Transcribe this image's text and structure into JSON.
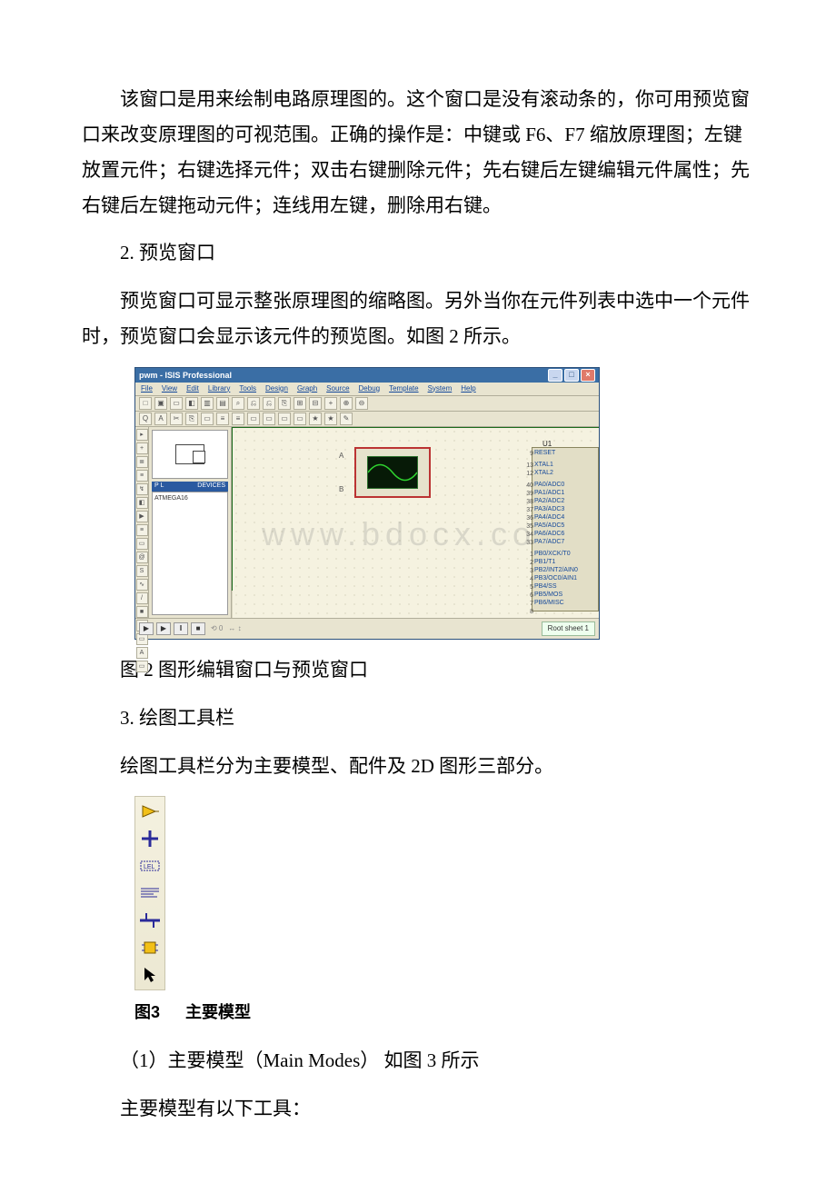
{
  "paragraphs": {
    "p1": "该窗口是用来绘制电路原理图的。这个窗口是没有滚动条的，你可用预览窗口来改变原理图的可视范围。正确的操作是：中键或 F6、F7 缩放原理图；左键放置元件；右键选择元件；双击右键删除元件；先右键后左键编辑元件属性；先右键后左键拖动元件；连线用左键，删除用右键。",
    "p2": "2. 预览窗口",
    "p3": "预览窗口可显示整张原理图的缩略图。另外当你在元件列表中选中一个元件时，预览窗口会显示该元件的预览图。如图 2 所示。",
    "caption2": "图 2 图形编辑窗口与预览窗口",
    "p4": "3. 绘图工具栏",
    "p5": "绘图工具栏分为主要模型、配件及 2D 图形三部分。",
    "fig3_left": "图3",
    "fig3_right": "主要模型",
    "p6": "（1）主要模型（Main Modes）  如图 3 所示",
    "p7": "主要模型有以下工具："
  },
  "watermark": "www.bdocx.com",
  "isis": {
    "title": "pwm - ISIS Professional",
    "window_buttons": {
      "min": "_",
      "max": "□",
      "close": "×"
    },
    "menus": [
      "File",
      "View",
      "Edit",
      "Library",
      "Tools",
      "Design",
      "Graph",
      "Source",
      "Debug",
      "Template",
      "System",
      "Help"
    ],
    "toolbar_icons": [
      "□",
      "▣",
      "▭",
      "◧",
      "▥",
      "▤",
      "⌕",
      "⎌",
      "⎌",
      "⎘",
      "⊞",
      "⊟",
      "+",
      "⊕",
      "⊖",
      "Q",
      "A",
      "✂",
      "⎘",
      "▭",
      "≡",
      "≡",
      "▭",
      "▭",
      "▭",
      "▭",
      "★",
      "★",
      "✎"
    ],
    "left_tools": [
      "▸",
      "+",
      "≣",
      "≡",
      "↯",
      "◧",
      "▶",
      "≡",
      "▭",
      "@",
      "S",
      "∿",
      "/",
      "■",
      "●",
      "▭",
      "A",
      "▭"
    ],
    "side": {
      "header_left": "P  L",
      "header_right": "DEVICES",
      "list": [
        "ATMEGA16"
      ]
    },
    "scope": {
      "labelA": "A",
      "labelB": "B"
    },
    "chip": {
      "ref": "U1",
      "pins": [
        {
          "num": "9",
          "name": "RESET"
        },
        {
          "num": "13",
          "name": "XTAL1"
        },
        {
          "num": "12",
          "name": "XTAL2"
        },
        {
          "num": "40",
          "name": "PA0/ADC0"
        },
        {
          "num": "39",
          "name": "PA1/ADC1"
        },
        {
          "num": "38",
          "name": "PA2/ADC2"
        },
        {
          "num": "37",
          "name": "PA3/ADC3"
        },
        {
          "num": "36",
          "name": "PA4/ADC4"
        },
        {
          "num": "35",
          "name": "PA5/ADC5"
        },
        {
          "num": "34",
          "name": "PA6/ADC6"
        },
        {
          "num": "33",
          "name": "PA7/ADC7"
        },
        {
          "num": "1",
          "name": "PB0/XCK/T0"
        },
        {
          "num": "2",
          "name": "PB1/T1"
        },
        {
          "num": "3",
          "name": "PB2/INT2/AIN0"
        },
        {
          "num": "4",
          "name": "PB3/OC0/AIN1"
        },
        {
          "num": "5",
          "name": "PB4/SS"
        },
        {
          "num": "6",
          "name": "PB5/MOS"
        },
        {
          "num": "7",
          "name": "PB6/MISC"
        },
        {
          "num": "8",
          "name": ""
        }
      ]
    },
    "status": {
      "buttons": [
        "▶",
        "▶",
        "‖",
        "■"
      ],
      "sheet": "Root sheet 1"
    }
  },
  "palette_icons": [
    "component-icon",
    "junction-icon",
    "label-icon",
    "script-icon",
    "bus-icon",
    "subcircuit-icon",
    "pointer-icon"
  ]
}
